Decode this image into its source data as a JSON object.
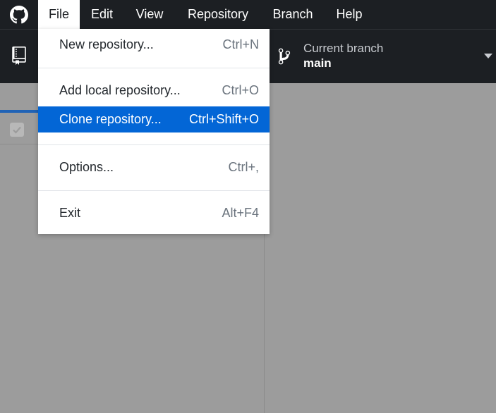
{
  "menubar": {
    "items": [
      {
        "label": "File",
        "open": true
      },
      {
        "label": "Edit"
      },
      {
        "label": "View"
      },
      {
        "label": "Repository"
      },
      {
        "label": "Branch"
      },
      {
        "label": "Help"
      }
    ]
  },
  "toolbar": {
    "repo_icon": "repo-icon",
    "branch": {
      "caption": "Current branch",
      "name": "main",
      "icon": "git-branch-icon"
    }
  },
  "file_menu": {
    "items": [
      {
        "label": "New repository...",
        "shortcut": "Ctrl+N"
      },
      {
        "label": "Add local repository...",
        "shortcut": "Ctrl+O"
      },
      {
        "label": "Clone repository...",
        "shortcut": "Ctrl+Shift+O",
        "selected": true
      },
      {
        "label": "Options...",
        "shortcut": "Ctrl+,"
      },
      {
        "label": "Exit",
        "shortcut": "Alt+F4"
      }
    ]
  },
  "colors": {
    "menubar_bg": "#1c1f23",
    "selected_bg": "#0366d6",
    "overlay_bg": "#9c9c9c"
  }
}
